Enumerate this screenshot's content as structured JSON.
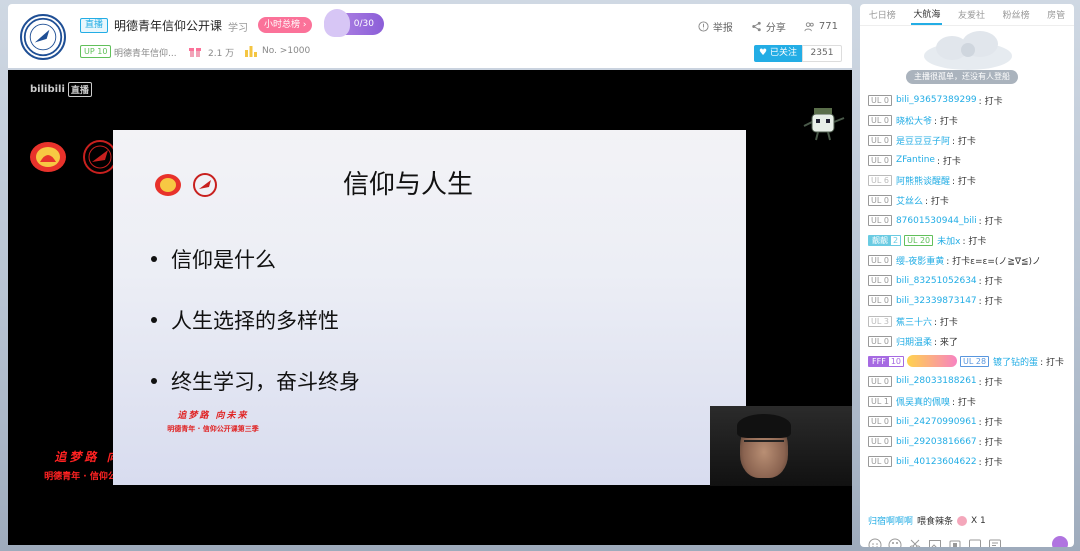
{
  "header": {
    "live_badge": "直播",
    "title": "明德青年信仰公开课",
    "area": "学习",
    "hour_rank": "小时总榜 ›",
    "mascot_progress": "0/30",
    "actions": [
      {
        "icon": "report-icon",
        "label": "举报"
      },
      {
        "icon": "share-icon",
        "label": "分享"
      },
      {
        "icon": "viewers-icon",
        "label": "771"
      }
    ],
    "up_level": "UP 10",
    "uploader_name": "明德青年信仰...",
    "gift_count": "2.1 万",
    "rank_text": "No. >1000",
    "follow_label": "♥ 已关注",
    "follower_count": "2351"
  },
  "player": {
    "logo_text": "bilibili",
    "logo_live": "直播",
    "slogan_line1": "追梦路 向未来",
    "slogan_line2": "明德青年 · 信仰公开课第三季",
    "slide": {
      "title": "信仰与人生",
      "bullets": [
        "信仰是什么",
        "人生选择的多样性",
        "终生学习，奋斗终身"
      ],
      "slogan_line1": "追梦路 向未来",
      "slogan_line2": "明德青年 · 信仰公开课第三季"
    }
  },
  "side": {
    "tabs": [
      "七日榜",
      "大航海",
      "友爱社",
      "粉丝榜",
      "房管"
    ],
    "active_tab": "大航海",
    "rank_empty_text": "主播很孤单，还没有人登船",
    "danmaku": [
      {
        "ul": "UL 0",
        "user": "bili_93657389299",
        "text": "打卡"
      },
      {
        "ul": "UL 0",
        "user": "晓松大爷",
        "text": "打卡"
      },
      {
        "ul": "UL 0",
        "user": "是豆豆豆子阿",
        "text": "打卡"
      },
      {
        "ul": "UL 0",
        "user": "ZFantine",
        "text": "打卡"
      },
      {
        "ul": "UL 6",
        "user": "阿熊熊谈醒醒",
        "text": "打卡"
      },
      {
        "ul": "UL 0",
        "user": "艾丝么",
        "text": "打卡"
      },
      {
        "ul": "UL 0",
        "user": "87601530944_bili",
        "text": "打卡"
      },
      {
        "medal": "靓靓",
        "medal_level": "2",
        "ul": "UL 20",
        "user": "未加x",
        "text": "打卡"
      },
      {
        "ul": "UL 0",
        "user": "缨-夜影重黄",
        "text": "打卡ε=ε=(ノ≧∇≦)ノ"
      },
      {
        "ul": "UL 0",
        "user": "bili_83251052634",
        "text": "打卡"
      },
      {
        "ul": "UL 0",
        "user": "bili_32339873147",
        "text": "打卡"
      },
      {
        "ul": "UL 3",
        "user": "蕉三十六",
        "text": "打卡"
      },
      {
        "ul": "UL 0",
        "user": "归期温柔",
        "text": "来了"
      },
      {
        "medal": "FFF",
        "medal_level": "10",
        "ul": "UL 28",
        "user": "镀了钻的蛋",
        "text": "打卡"
      },
      {
        "ul": "UL 0",
        "user": "bili_28033188261",
        "text": "打卡"
      },
      {
        "ul": "UL 1",
        "user": "佩吴真的佩嗅",
        "text": "打卡"
      },
      {
        "ul": "UL 0",
        "user": "bili_24270990961",
        "text": "打卡"
      },
      {
        "ul": "UL 0",
        "user": "bili_29203816667",
        "text": "打卡"
      },
      {
        "ul": "UL 0",
        "user": "bili_40123604622",
        "text": "打卡"
      }
    ],
    "gift_user": "归宿啊啊啊",
    "gift_action": "喂食辣条",
    "gift_count": "X 1"
  },
  "colors": {
    "accent": "#23ade5",
    "pink": "#fb7299",
    "player_bg": "#000000"
  }
}
